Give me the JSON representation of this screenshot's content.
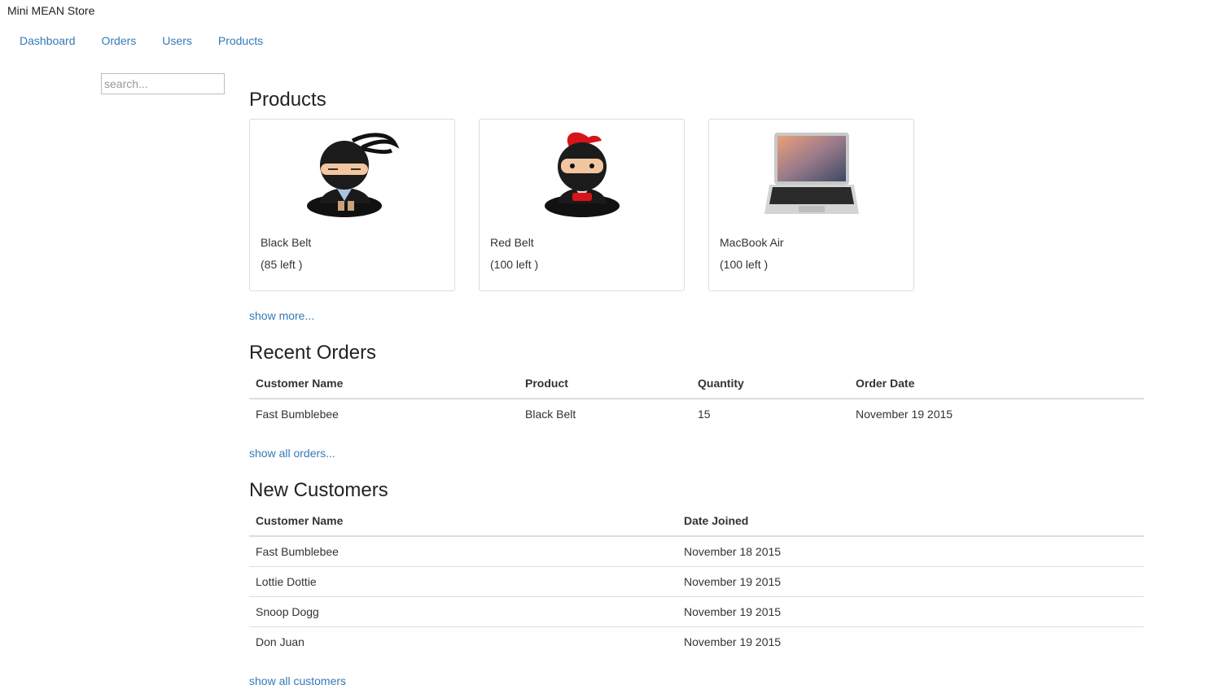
{
  "brand": "Mini MEAN Store",
  "nav": [
    "Dashboard",
    "Orders",
    "Users",
    "Products"
  ],
  "search": {
    "placeholder": "search..."
  },
  "products": {
    "title": "Products",
    "items": [
      {
        "name": "Black Belt",
        "stock": "(85 left )",
        "icon": "black-ninja-icon"
      },
      {
        "name": "Red Belt",
        "stock": "(100 left )",
        "icon": "red-ninja-icon"
      },
      {
        "name": "MacBook Air",
        "stock": "(100 left )",
        "icon": "laptop-icon"
      }
    ],
    "more_label": "show more..."
  },
  "orders": {
    "title": "Recent Orders",
    "headers": [
      "Customer Name",
      "Product",
      "Quantity",
      "Order Date"
    ],
    "rows": [
      [
        "Fast Bumblebee",
        "Black Belt",
        "15",
        "November 19 2015"
      ]
    ],
    "more_label": "show all orders..."
  },
  "customers": {
    "title": "New Customers",
    "headers": [
      "Customer Name",
      "Date Joined"
    ],
    "rows": [
      [
        "Fast Bumblebee",
        "November 18 2015"
      ],
      [
        "Lottie Dottie",
        "November 19 2015"
      ],
      [
        "Snoop Dogg",
        "November 19 2015"
      ],
      [
        "Don Juan",
        "November 19 2015"
      ]
    ],
    "more_label": "show all customers"
  }
}
